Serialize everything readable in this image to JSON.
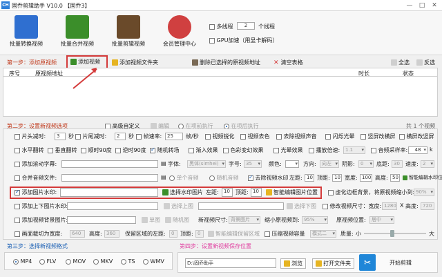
{
  "window": {
    "logo": "CH",
    "title": "固乔剪辑助手 V10.0 【固乔3】",
    "buttons": [
      "—",
      "□",
      "✕"
    ]
  },
  "toolbar": {
    "items": [
      {
        "label": "批量转换视频",
        "icon": "convert-video-icon",
        "color": "#2f6fd0"
      },
      {
        "label": "批量合并视频",
        "icon": "merge-video-icon",
        "color": "#3b8e2a"
      },
      {
        "label": "批量剪辑视频",
        "icon": "film-scissors-icon",
        "color": "#6a4a2a"
      },
      {
        "label": "会员管理中心",
        "icon": "member-icon",
        "color": "#d04040"
      }
    ],
    "multithread_label": "多线程",
    "thread_count": "2",
    "thread_unit": "个线程",
    "gpu_label": "GPU加速（用显卡解码）"
  },
  "step1": {
    "label": "第一步：添加原视频",
    "add_video": "添加视频",
    "add_folder": "添加视频文件夹",
    "delete_selected": "删除已选择的原视频地址",
    "clear_table": "清空表格",
    "select_all": "全选",
    "invert": "反选",
    "columns": [
      "序号",
      "原视频地址",
      "时长",
      "状态"
    ]
  },
  "step2": {
    "label": "第二步：设置新视频选项",
    "advanced": "高级自定义",
    "edit": "编辑",
    "before_exec": "在项前执行",
    "after_exec": "在项后执行",
    "total": "共 1 个视频"
  },
  "rows": {
    "r1": {
      "head_cut": "片头减时:",
      "head_val": "3",
      "sec1": "秒",
      "tail_cut": "片尾减时:",
      "tail_val": "2",
      "sec2": "秒",
      "fps_label": "帧速率:",
      "fps_val": "25",
      "fps_unit": "帧/秒",
      "sharpen": "视频锐化",
      "decolor": "视频去色",
      "remove_audio": "去除视频声音",
      "flash": "闪烁光晕",
      "vertical_blur": "竖屏改横屏",
      "landscape_blur": "横屏改竖屏"
    },
    "r2": {
      "hflip": "水平翻转",
      "vflip": "垂直翻转",
      "rot90": "顺时90度",
      "ccw90": "逆时90度",
      "random_transition": "随机转场",
      "fade": "渐入效果",
      "color_shift": "色彩变幻效果",
      "glare": "光晕效果",
      "speed": "播放倍速:",
      "speed_val": "1.1",
      "samplerate": "音频采样率:",
      "samplerate_val": "48",
      "samplerate_unit": "k"
    },
    "r3": {
      "subtitle": "添加滚动字幕:",
      "font": "字体:",
      "font_val": "黑体(simhei)",
      "fontsize": "字号:",
      "fontsize_val": "35",
      "color": "颜色:",
      "direction": "方向:",
      "direction_val": "向左",
      "shadow": "阴影:",
      "shadow_val": "0",
      "bottom": "底距:",
      "bottom_val": "30",
      "speed": "速度:",
      "speed_val": "2"
    },
    "r4": {
      "music": "合并音频文件:",
      "single_audio": "单个音频",
      "random_audio": "随机音频",
      "remove_watermark": "去除视频水印",
      "left": "左距:",
      "left_val": "10",
      "top": "顶距:",
      "top_val": "10",
      "width": "宽度:",
      "width_val": "100",
      "height": "高度:",
      "height_val": "50",
      "smart": "智能编辑水印位置"
    },
    "r5": {
      "image_watermark": "添加图片水印:",
      "choose_image": "选择水印图片",
      "left": "左距:",
      "left_val": "10",
      "top": "顶距:",
      "top_val": "10",
      "smart": "智能编辑图片位置",
      "blur_bg": "虚化边框背景，将原视频缩小到:",
      "blur_val": "90%"
    },
    "r6": {
      "tb_watermark": "添加上下图片水印:",
      "choose_top": "选择上图",
      "choose_bottom": "选择下图",
      "modify_res": "修改视频尺寸：宽度:",
      "res_w": "1280",
      "x": "X",
      "res_h_label": "高度:",
      "res_h": "720"
    },
    "r7": {
      "bg_image": "添加视频背景图片:",
      "single_image": "单图",
      "random_image": "随机图",
      "new_size": "新视频尺寸:",
      "new_size_val": "背景图片",
      "shrink": "缩小原视频到:",
      "shrink_val": "95%",
      "position": "原视频位置:",
      "position_val": "居中"
    },
    "r8": {
      "crop": "画面裁切为宽度:",
      "crop_w": "640",
      "crop_h_label": "高度:",
      "crop_h": "360",
      "keep_left": "保留区域的左距:",
      "keep_left_val": "0",
      "keep_top": "顶距:",
      "keep_top_val": "0",
      "smart_crop": "智能编辑保留区域",
      "compress": "压缩视频容量",
      "mode_val": "模式二",
      "quality": "质量:",
      "small": "小",
      "large": "大"
    }
  },
  "step3": {
    "label": "第三步：选择新视频格式",
    "formats": [
      "MP4",
      "FLV",
      "MOV",
      "MKV",
      "TS",
      "WMV"
    ]
  },
  "step4": {
    "label": "第四步：设置新视频保存位置",
    "path": "D:\\固乔助手",
    "browse": "浏览",
    "open_folder": "打开文件夹",
    "start": "开始剪辑"
  },
  "colors": {
    "accent": "#1a5fb4",
    "step_red": "#c0391b",
    "highlight": "#d43a3a",
    "pink": "#e040a0"
  }
}
